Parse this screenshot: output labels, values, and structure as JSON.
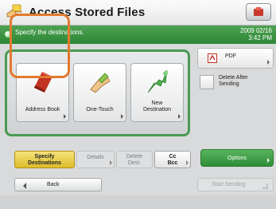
{
  "header": {
    "title": "Access Stored Files",
    "mode_icon": "counter-check-icon"
  },
  "status": {
    "message": "Specify the destinations.",
    "date": "2009 02/16",
    "time": "3:42 PM"
  },
  "destinations": {
    "address_book": "Address Book",
    "one_touch": "One-Touch",
    "new_destination_line1": "New",
    "new_destination_line2": "Destination"
  },
  "tabs": {
    "specify_line1": "Specify",
    "specify_line2": "Destinations",
    "details": "Details",
    "delete_line1": "Delete",
    "delete_line2": "Dest.",
    "cc_line1": "Cc",
    "cc_line2": "Bcc"
  },
  "side": {
    "format": "PDF",
    "delete_after_line1": "Delete After",
    "delete_after_line2": "Sending",
    "options": "Options",
    "start_sending": "Start Sending"
  },
  "nav": {
    "back": "Back"
  },
  "colors": {
    "accent_green": "#2c8734",
    "highlight_orange": "#e27a2e",
    "active_tab_yellow": "#dcbc2a"
  }
}
